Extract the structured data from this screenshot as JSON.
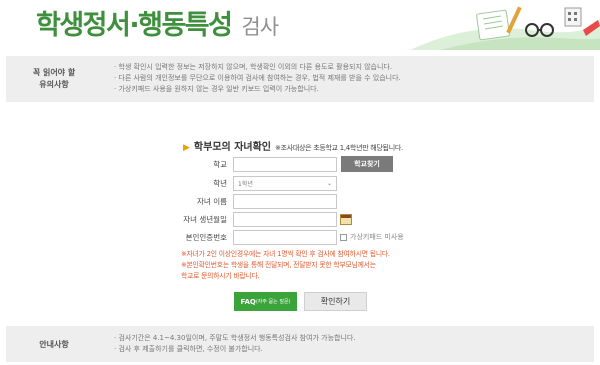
{
  "header": {
    "title": "학생정서·행동특성",
    "subtitle": "검사"
  },
  "notice": {
    "label_line1": "꼭 읽어야 할",
    "label_line2": "유의사항",
    "items": [
      "· 학생 확인시 입력한 정보는 저장하지 않으며, 학생확인 이외의 다른 용도로 활용되지 않습니다.",
      "· 다른 사람의 개인정보를 무단으로 이용하여 검사에 참여하는 경우, 법적 제재를 받을 수 있습니다.",
      "· 가상키패드 사용을 원하지 않는 경우 일반 키보드 입력이 가능합니다."
    ]
  },
  "form": {
    "title": "학부모의 자녀확인",
    "note": "※조사대상은 초등학교 1,4학년만 해당됩니다.",
    "school_label": "학교",
    "school_button": "학교찾기",
    "grade_label": "학년",
    "grade_value": "1학년",
    "name_label": "자녀 이름",
    "birth_label": "자녀 생년월일",
    "id_label": "본인인증번호",
    "keypad_label": "가상키패드 미사용",
    "warnings": [
      "※자녀가 2인 이상인경우에는 자녀 1명씩 확인 후 검사에 참여하시면 됩니다.",
      "※본인확인번호는 학생을 통해 전달되며, 전달받지 못한 학부모님께서는",
      "학교로 문의하시기 바랍니다."
    ]
  },
  "buttons": {
    "faq": "FAQ",
    "faq_small": "(자주 묻는 질문)",
    "confirm": "확인하기"
  },
  "guide": {
    "label": "안내사항",
    "items": [
      "· 검사기간은 4.1~4.30일이며, 주말도 학생정서 행동특성검사 참여가 가능합니다.",
      "· 검사 후 제출하기를 클릭하면, 수정이 불가합니다."
    ]
  },
  "colors": {
    "brand_green": "#3e8f3e",
    "button_green": "#3aa33a",
    "warning_orange": "#e05a2e"
  }
}
